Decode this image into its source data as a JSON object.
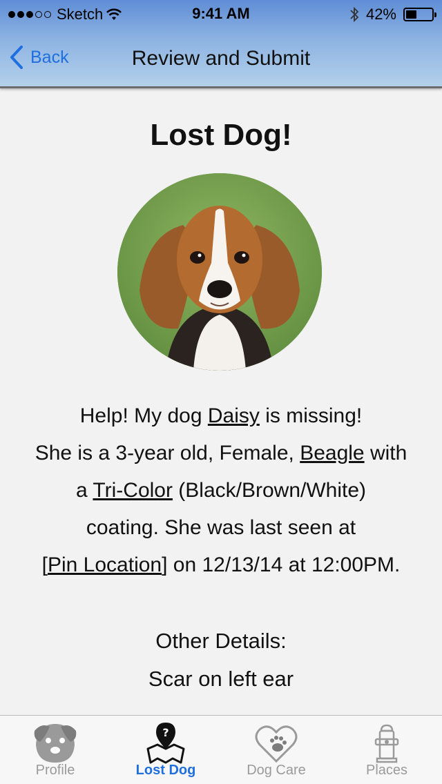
{
  "status_bar": {
    "carrier": "Sketch",
    "time": "9:41 AM",
    "battery_percent": "42%",
    "battery_level": 0.42,
    "signal_dots_filled": 3,
    "signal_dots_total": 5
  },
  "nav": {
    "back_label": "Back",
    "title": "Review and Submit"
  },
  "main": {
    "title": "Lost Dog!",
    "description": {
      "line1_prefix": "Help! My dog ",
      "dog_name": "Daisy",
      "line1_suffix": " is missing!",
      "line2_prefix": "She is a 3-year old, Female, ",
      "breed": "Beagle",
      "line2_suffix": " with",
      "line3_prefix": "a ",
      "color": "Tri-Color",
      "line3_suffix": " (Black/Brown/White)",
      "line4": "coating.  She was last seen at",
      "line5_open": "[",
      "location": "Pin Location",
      "line5_suffix": "] on 12/13/14 at 12:00PM."
    },
    "other_details_label": "Other Details:",
    "other_details_value": "Scar on left ear"
  },
  "tab_bar": {
    "tabs": [
      {
        "label": "Profile",
        "icon": "dog-face-icon",
        "active": false
      },
      {
        "label": "Lost Dog",
        "icon": "lost-dog-map-icon",
        "active": true
      },
      {
        "label": "Dog Care",
        "icon": "heart-paw-icon",
        "active": false
      },
      {
        "label": "Places",
        "icon": "fire-hydrant-icon",
        "active": false
      }
    ]
  },
  "colors": {
    "accent": "#1f6fe0",
    "inactive_tab": "#9a9a9a",
    "background": "#f2f2f2"
  }
}
